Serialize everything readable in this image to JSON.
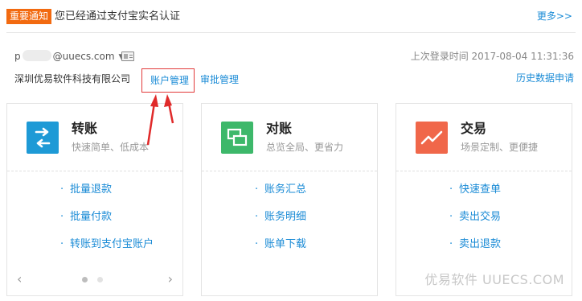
{
  "notice": {
    "badge": "重要通知",
    "text": "您已经通过支付宝实名认证",
    "more": "更多>>"
  },
  "account": {
    "email_prefix": "p",
    "email_domain": "@uuecs.com",
    "last_login": "上次登录时间 2017-08-04 11:31:36",
    "company": "深圳优易软件科技有限公司",
    "account_mgmt": "账户管理",
    "approval_mgmt": "审批管理",
    "history_query": "历史数据申请"
  },
  "cards": [
    {
      "title": "转账",
      "subtitle": "快速简单、低成本",
      "icon": "transfer-icon",
      "color": "#1e9ad6",
      "links": [
        "批量退款",
        "批量付款",
        "转账到支付宝账户"
      ]
    },
    {
      "title": "对账",
      "subtitle": "总览全局、更省力",
      "icon": "reconcile-icon",
      "color": "#3db86a",
      "links": [
        "账务汇总",
        "账务明细",
        "账单下载"
      ]
    },
    {
      "title": "交易",
      "subtitle": "场景定制、更便捷",
      "icon": "trade-chart-icon",
      "color": "#f0674a",
      "links": [
        "快速查单",
        "卖出交易",
        "卖出退款"
      ]
    }
  ],
  "pager": {
    "prev": "‹",
    "next": "›"
  },
  "watermark": "优易软件 UUECS.COM",
  "accent_color": "#1a8bd6",
  "highlight_color": "#e23a3a"
}
